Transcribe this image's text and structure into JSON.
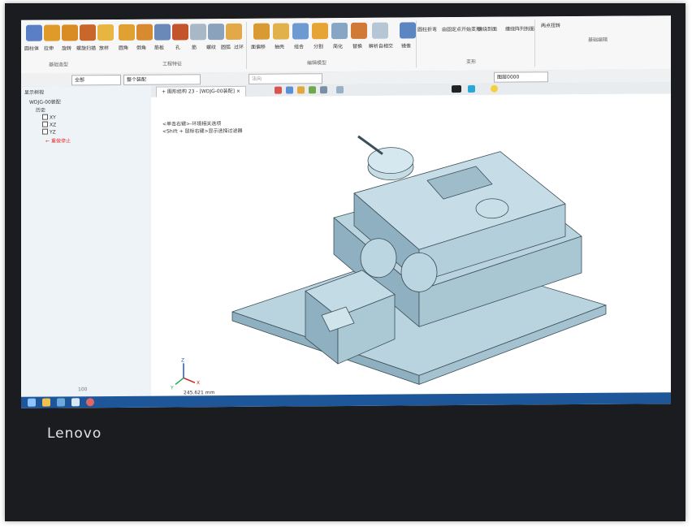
{
  "ribbon": {
    "tools": [
      "圆柱体",
      "拉伸",
      "旋转",
      "螺旋扫描",
      "放样",
      "圆角",
      "倒角",
      "筋板",
      "孔",
      "筋",
      "螺纹",
      "圆弧",
      "过环",
      "面偏移",
      "抽壳",
      "组合",
      "分割",
      "简化",
      "替换",
      "解析自相交",
      "镜像",
      "圆柱折弯",
      "由固定点开始变形",
      "缠绕到面",
      "缠绕阵列到面",
      "两点扭转",
      "基础编辑"
    ],
    "groups": [
      "基础造型",
      "工程特征",
      "编辑模型",
      "变形",
      "基础编辑"
    ]
  },
  "toolbar2": {
    "filter_value": "全部",
    "assembly_value": "整个装配",
    "normal_placeholder": "法向",
    "layer_value": "图层0000"
  },
  "tree": {
    "title": "显示树视",
    "root": "WDJG-00装配",
    "history": "历史",
    "planes": [
      "XY",
      "XZ",
      "YZ"
    ],
    "stop_label": "重做停止",
    "footer": "100"
  },
  "document_tab": {
    "label": "+ 图形结构 23 - [WDJG-00装配]",
    "close": "×"
  },
  "viewport": {
    "hint_line1": "<单击右键>-环境相关选项",
    "hint_line2": "<Shift + 鼠标右键>显示选择过滤器",
    "measure": "245.621 mm",
    "axis_labels": [
      "X",
      "Y",
      "Z"
    ]
  },
  "monitor": {
    "brand": "Lenovo"
  },
  "colors": {
    "model_fill": "#b9d3df",
    "model_shadow": "#8fb0c0",
    "model_edge": "#3d4f58",
    "bezel": "#1a1c1f",
    "taskbar": "#1e5799"
  }
}
